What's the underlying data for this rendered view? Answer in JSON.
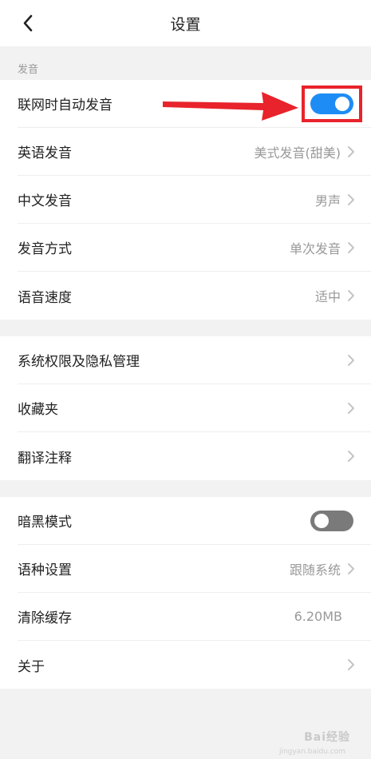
{
  "header": {
    "title": "设置"
  },
  "section_sound": {
    "label": "发音"
  },
  "sound_items": [
    {
      "label": "联网时自动发音",
      "toggle": "on"
    },
    {
      "label": "英语发音",
      "value": "美式发音(甜美)"
    },
    {
      "label": "中文发音",
      "value": "男声"
    },
    {
      "label": "发音方式",
      "value": "单次发音"
    },
    {
      "label": "语音速度",
      "value": "适中"
    }
  ],
  "misc_items": [
    {
      "label": "系统权限及隐私管理"
    },
    {
      "label": "收藏夹"
    },
    {
      "label": "翻译注释"
    }
  ],
  "other_items": [
    {
      "label": "暗黑模式",
      "toggle": "off"
    },
    {
      "label": "语种设置",
      "value": "跟随系统"
    },
    {
      "label": "清除缓存",
      "value": "6.20MB"
    },
    {
      "label": "关于"
    }
  ],
  "watermark": {
    "text": "Bai经验",
    "sub": "jingyan.baidu.com"
  },
  "colors": {
    "toggle_on": "#1e8cf5",
    "toggle_off": "#7a7a7a",
    "highlight": "#e8232b"
  },
  "icons": {
    "back": "chevron-left-icon",
    "row": "chevron-right-icon"
  }
}
